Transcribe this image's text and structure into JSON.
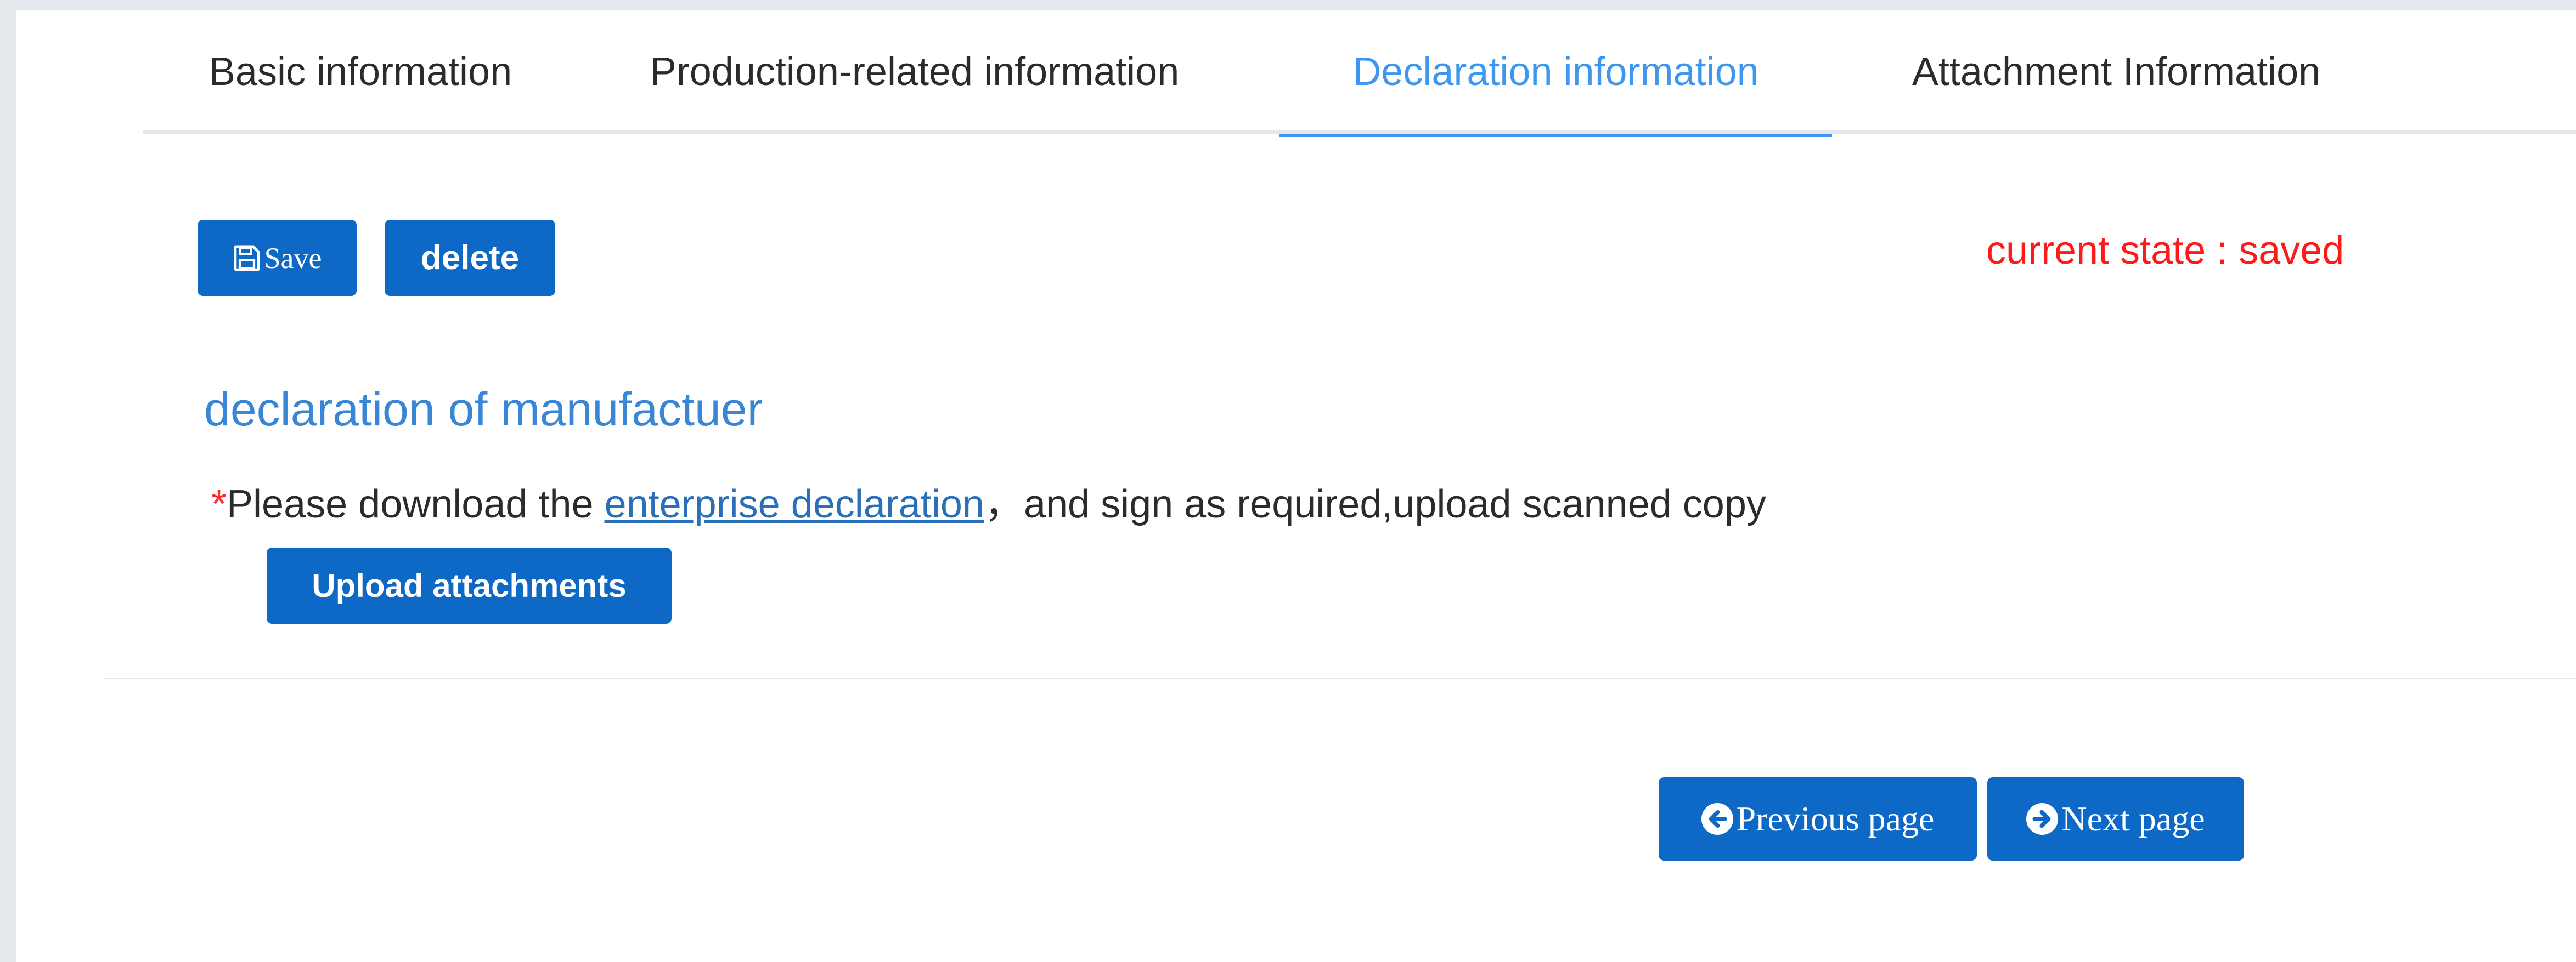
{
  "tabs": [
    {
      "label": "Basic information",
      "active": false
    },
    {
      "label": "Production-related information",
      "active": false
    },
    {
      "label": "Declaration information",
      "active": true
    },
    {
      "label": "Attachment Information",
      "active": false
    }
  ],
  "toolbar": {
    "save_label": "Save",
    "delete_label": "delete",
    "state_text": "current state : saved"
  },
  "declaration": {
    "title": "declaration of manufactuer",
    "required_mark": "*",
    "text_before": "Please download the ",
    "link_text": "enterprise declaration",
    "text_after": "，and sign as required,upload scanned copy",
    "upload_label": "Upload attachments"
  },
  "pager": {
    "previous_label": "Previous page",
    "next_label": "Next page"
  },
  "icons": {
    "save": "floppy-disk-icon",
    "previous": "circle-arrow-left-icon",
    "next": "circle-arrow-right-icon"
  },
  "colors": {
    "primary_button": "#0d69c5",
    "active_tab": "#3d97f0",
    "state_text": "#ff1a1a",
    "section_title": "#3a86d6",
    "link": "#2a6fb8",
    "required_mark": "#ff2a2a"
  }
}
